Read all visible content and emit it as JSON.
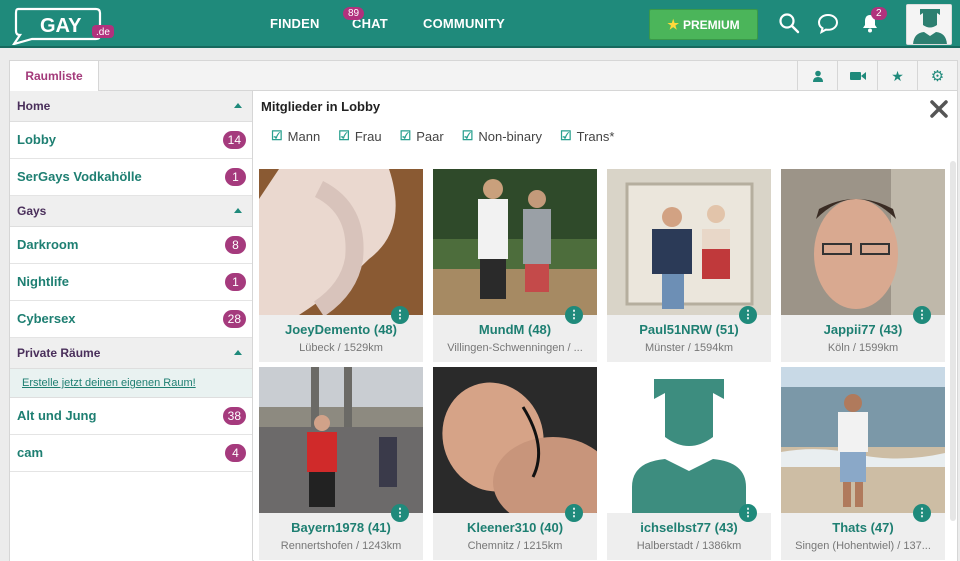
{
  "header": {
    "logo_text": "GAY",
    "logo_sub": ".de",
    "nav": [
      {
        "label": "FINDEN"
      },
      {
        "label": "CHAT",
        "badge": "89"
      },
      {
        "label": "COMMUNITY"
      }
    ],
    "premium_label": "PREMIUM",
    "notifications_badge": "2",
    "icons": [
      "search-icon",
      "chat-bubble-icon",
      "bell-icon",
      "avatar"
    ]
  },
  "tabs": {
    "active": "Raumliste",
    "tools": [
      "user-icon",
      "video-camera-icon",
      "star-icon",
      "gear-icon"
    ]
  },
  "sidebar": {
    "sections": [
      {
        "label": "Home"
      },
      {
        "label": "Gays"
      },
      {
        "label": "Private Räume"
      }
    ],
    "rooms": [
      {
        "label": "Lobby",
        "count": "14"
      },
      {
        "label": "SerGays Vodkahölle",
        "count": "1"
      },
      {
        "label": "Darkroom",
        "count": "8"
      },
      {
        "label": "Nightlife",
        "count": "1"
      },
      {
        "label": "Cybersex",
        "count": "28"
      },
      {
        "label": "Alt und Jung",
        "count": "38"
      },
      {
        "label": "cam",
        "count": "4"
      }
    ],
    "create_link": "Erstelle jetzt deinen eigenen Raum!"
  },
  "main": {
    "title": "Mitglieder in Lobby",
    "filters": [
      "Mann",
      "Frau",
      "Paar",
      "Non-binary",
      "Trans*"
    ],
    "members": [
      {
        "name": "JoeyDemento (48)",
        "location": "Lübeck / 1529km"
      },
      {
        "name": "MundM (48)",
        "location": "Villingen-Schwenningen / ..."
      },
      {
        "name": "Paul51NRW (51)",
        "location": "Münster / 1594km"
      },
      {
        "name": "Jappii77 (43)",
        "location": "Köln / 1599km"
      },
      {
        "name": "Bayern1978 (41)",
        "location": "Rennertshofen / 1243km"
      },
      {
        "name": "Kleener310 (40)",
        "location": "Chemnitz / 1215km"
      },
      {
        "name": "ichselbst77 (43)",
        "location": "Halberstadt / 1386km"
      },
      {
        "name": "Thats (47)",
        "location": "Singen (Hohentwiel) / 137..."
      }
    ]
  },
  "colors": {
    "brand": "#1f8a7b",
    "badge": "#a53a7d",
    "premium": "#4bb55a"
  }
}
